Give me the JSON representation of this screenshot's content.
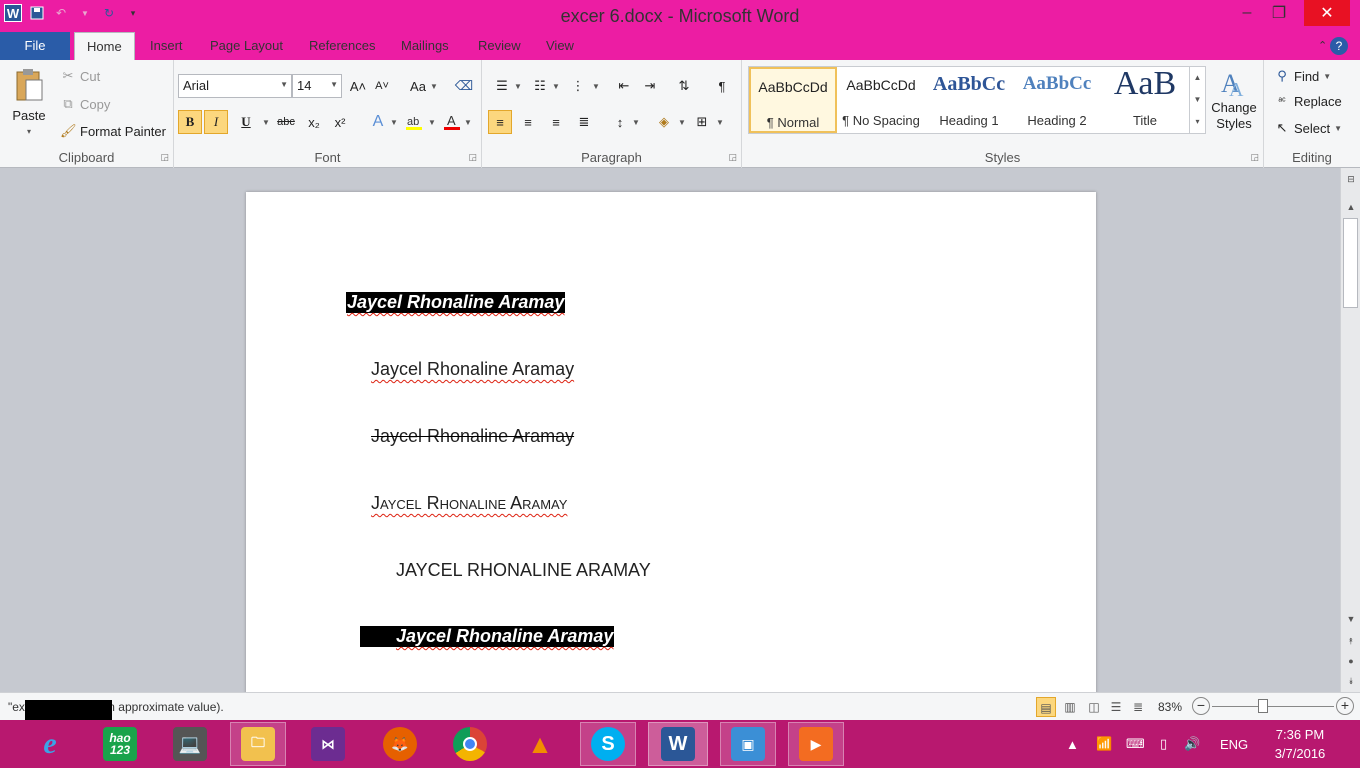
{
  "window": {
    "title": "excer 6.docx  -  Microsoft Word",
    "qat_logo": "W"
  },
  "ribbon_tabs": [
    "File",
    "Home",
    "Insert",
    "Page Layout",
    "References",
    "Mailings",
    "Review",
    "View"
  ],
  "clipboard": {
    "paste": "Paste",
    "cut": "Cut",
    "copy": "Copy",
    "format_painter": "Format Painter",
    "label": "Clipboard"
  },
  "font": {
    "family": "Arial",
    "size": "14",
    "label": "Font",
    "bold": "B",
    "italic": "I",
    "underline": "U",
    "strike": "abc",
    "subscript": "x₂",
    "superscript": "x²",
    "grow": "A˄",
    "shrink": "A˅",
    "change_case": "Aa"
  },
  "paragraph": {
    "label": "Paragraph",
    "pilcrow": "¶"
  },
  "styles": {
    "label": "Styles",
    "items": [
      {
        "preview": "AaBbCcDd",
        "name": "¶ Normal"
      },
      {
        "preview": "AaBbCcDd",
        "name": "¶ No Spacing"
      },
      {
        "preview": "AaBbCc",
        "name": "Heading 1"
      },
      {
        "preview": "AaBbCc",
        "name": "Heading 2"
      },
      {
        "preview": "AaB",
        "name": "Title"
      }
    ],
    "change_styles": "Change Styles"
  },
  "editing": {
    "label": "Editing",
    "find": "Find",
    "replace": "Replace",
    "select": "Select"
  },
  "document": {
    "lines": [
      "Jaycel Rhonaline Aramay",
      "Jaycel Rhonaline Aramay",
      "Jaycel Rhonaline Aramay",
      "Jaycel Rhonaline Aramay",
      "JAYCEL RHONALINE ARAMAY",
      "Jaycel Rhonaline Aramay"
    ]
  },
  "status": {
    "text": "\"ex                    0 characters (an approximate value).",
    "zoom": "83%"
  },
  "taskbar": {
    "apps": [
      "ie-icon",
      "hao123-icon",
      "laptop-icon",
      "file-explorer-icon",
      "visual-studio-icon",
      "firefox-icon",
      "chrome-icon",
      "vlc-icon",
      "skype-icon",
      "word-icon",
      "photos-icon",
      "media-player-icon"
    ],
    "hao123_label": "hao\n123",
    "lang": "ENG",
    "time": "7:36 PM",
    "date": "3/7/2016"
  }
}
